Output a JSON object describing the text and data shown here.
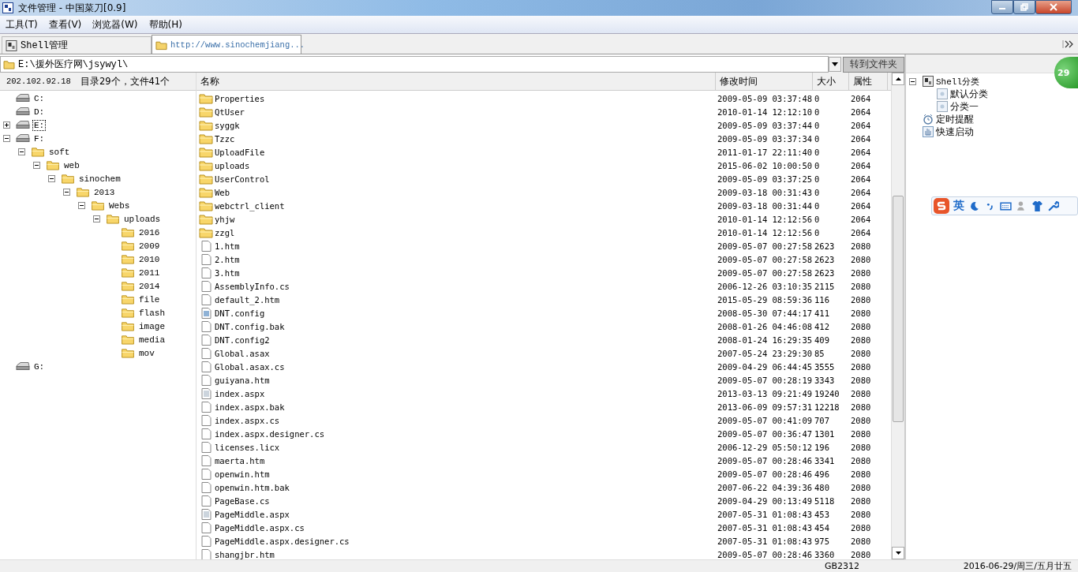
{
  "window": {
    "title": "文件管理 - 中国菜刀[0.9]"
  },
  "menu": [
    "工具(T)",
    "查看(V)",
    "浏览器(W)",
    "帮助(H)"
  ],
  "tabs": [
    {
      "label": "Shell管理",
      "kind": "shell",
      "selected": false
    },
    {
      "label": "http://www.sinochemjiang...",
      "kind": "folder",
      "selected": true
    }
  ],
  "path_bar": {
    "path": "E:\\援外医疗网\\jsywyl\\",
    "button": "转到文件夹"
  },
  "info": {
    "host": "202.102.92.18",
    "counts": "目录29个，文件41个"
  },
  "tree": [
    {
      "label": "C:",
      "kind": "drive",
      "selected": false
    },
    {
      "label": "D:",
      "kind": "drive",
      "selected": false
    },
    {
      "label": "E:",
      "kind": "drive",
      "selected": true,
      "expanded": false
    },
    {
      "label": "F:",
      "kind": "drive",
      "selected": false,
      "expanded": true,
      "children": [
        {
          "label": "soft",
          "kind": "folder",
          "selected": false,
          "expanded": true,
          "children": [
            {
              "label": "web",
              "kind": "folder",
              "selected": false,
              "expanded": true,
              "children": [
                {
                  "label": "sinochem",
                  "kind": "folder",
                  "selected": false,
                  "expanded": true,
                  "children": [
                    {
                      "label": "2013",
                      "kind": "folder",
                      "selected": false,
                      "expanded": true,
                      "children": [
                        {
                          "label": "Webs",
                          "kind": "folder",
                          "selected": false,
                          "expanded": true,
                          "children": [
                            {
                              "label": "uploads",
                              "kind": "folder",
                              "selected": false,
                              "expanded": true,
                              "children": [
                                {
                                  "label": "2016",
                                  "kind": "folder",
                                  "selected": false
                                },
                                {
                                  "label": "2009",
                                  "kind": "folder",
                                  "selected": false
                                },
                                {
                                  "label": "2010",
                                  "kind": "folder",
                                  "selected": false
                                },
                                {
                                  "label": "2011",
                                  "kind": "folder",
                                  "selected": false
                                },
                                {
                                  "label": "2014",
                                  "kind": "folder",
                                  "selected": false
                                },
                                {
                                  "label": "file",
                                  "kind": "folder",
                                  "selected": false
                                },
                                {
                                  "label": "flash",
                                  "kind": "folder",
                                  "selected": false
                                },
                                {
                                  "label": "image",
                                  "kind": "folder",
                                  "selected": false
                                },
                                {
                                  "label": "media",
                                  "kind": "folder",
                                  "selected": false
                                },
                                {
                                  "label": "mov",
                                  "kind": "folder",
                                  "selected": false
                                }
                              ]
                            }
                          ]
                        }
                      ]
                    }
                  ]
                }
              ]
            }
          ]
        }
      ]
    },
    {
      "label": "G:",
      "kind": "drive",
      "selected": false
    }
  ],
  "file_list": {
    "columns": [
      "名称",
      "修改时间",
      "大小",
      "属性"
    ],
    "rows": [
      {
        "name": "Properties",
        "kind": "folder",
        "modified": "2009-05-09 03:37:48",
        "size": "0",
        "attr": "2064"
      },
      {
        "name": "QtUser",
        "kind": "folder",
        "modified": "2010-01-14 12:12:10",
        "size": "0",
        "attr": "2064"
      },
      {
        "name": "syggk",
        "kind": "folder",
        "modified": "2009-05-09 03:37:44",
        "size": "0",
        "attr": "2064"
      },
      {
        "name": "Tzzc",
        "kind": "folder",
        "modified": "2009-05-09 03:37:34",
        "size": "0",
        "attr": "2064"
      },
      {
        "name": "UploadFile",
        "kind": "folder",
        "modified": "2011-01-17 22:11:40",
        "size": "0",
        "attr": "2064"
      },
      {
        "name": "uploads",
        "kind": "folder",
        "modified": "2015-06-02 10:00:50",
        "size": "0",
        "attr": "2064"
      },
      {
        "name": "UserControl",
        "kind": "folder",
        "modified": "2009-05-09 03:37:25",
        "size": "0",
        "attr": "2064"
      },
      {
        "name": "Web",
        "kind": "folder",
        "modified": "2009-03-18 00:31:43",
        "size": "0",
        "attr": "2064"
      },
      {
        "name": "webctrl_client",
        "kind": "folder",
        "modified": "2009-03-18 00:31:44",
        "size": "0",
        "attr": "2064"
      },
      {
        "name": "yhjw",
        "kind": "folder",
        "modified": "2010-01-14 12:12:56",
        "size": "0",
        "attr": "2064"
      },
      {
        "name": "zzgl",
        "kind": "folder",
        "modified": "2010-01-14 12:12:56",
        "size": "0",
        "attr": "2064"
      },
      {
        "name": "1.htm",
        "kind": "file",
        "modified": "2009-05-07 00:27:58",
        "size": "2623",
        "attr": "2080"
      },
      {
        "name": "2.htm",
        "kind": "file",
        "modified": "2009-05-07 00:27:58",
        "size": "2623",
        "attr": "2080"
      },
      {
        "name": "3.htm",
        "kind": "file",
        "modified": "2009-05-07 00:27:58",
        "size": "2623",
        "attr": "2080"
      },
      {
        "name": "AssemblyInfo.cs",
        "kind": "file",
        "modified": "2006-12-26 03:10:35",
        "size": "2115",
        "attr": "2080"
      },
      {
        "name": "default_2.htm",
        "kind": "file",
        "modified": "2015-05-29 08:59:36",
        "size": "116",
        "attr": "2080"
      },
      {
        "name": "DNT.config",
        "kind": "config",
        "modified": "2008-05-30 07:44:17",
        "size": "411",
        "attr": "2080"
      },
      {
        "name": "DNT.config.bak",
        "kind": "file",
        "modified": "2008-01-26 04:46:08",
        "size": "412",
        "attr": "2080"
      },
      {
        "name": "DNT.config2",
        "kind": "file",
        "modified": "2008-01-24 16:29:35",
        "size": "409",
        "attr": "2080"
      },
      {
        "name": "Global.asax",
        "kind": "file",
        "modified": "2007-05-24 23:29:30",
        "size": "85",
        "attr": "2080"
      },
      {
        "name": "Global.asax.cs",
        "kind": "file",
        "modified": "2009-04-29 06:44:45",
        "size": "3555",
        "attr": "2080"
      },
      {
        "name": "guiyana.htm",
        "kind": "file",
        "modified": "2009-05-07 00:28:19",
        "size": "3343",
        "attr": "2080"
      },
      {
        "name": "index.aspx",
        "kind": "text",
        "modified": "2013-03-13 09:21:49",
        "size": "19240",
        "attr": "2080"
      },
      {
        "name": "index.aspx.bak",
        "kind": "file",
        "modified": "2013-06-09 09:57:31",
        "size": "12218",
        "attr": "2080"
      },
      {
        "name": "index.aspx.cs",
        "kind": "file",
        "modified": "2009-05-07 00:41:09",
        "size": "707",
        "attr": "2080"
      },
      {
        "name": "index.aspx.designer.cs",
        "kind": "file",
        "modified": "2009-05-07 00:36:47",
        "size": "1301",
        "attr": "2080"
      },
      {
        "name": "licenses.licx",
        "kind": "file",
        "modified": "2006-12-29 05:50:12",
        "size": "196",
        "attr": "2080"
      },
      {
        "name": "maerta.htm",
        "kind": "file",
        "modified": "2009-05-07 00:28:46",
        "size": "3341",
        "attr": "2080"
      },
      {
        "name": "openwin.htm",
        "kind": "file",
        "modified": "2009-05-07 00:28:46",
        "size": "496",
        "attr": "2080"
      },
      {
        "name": "openwin.htm.bak",
        "kind": "file",
        "modified": "2007-06-22 04:39:36",
        "size": "480",
        "attr": "2080"
      },
      {
        "name": "PageBase.cs",
        "kind": "file",
        "modified": "2009-04-29 00:13:49",
        "size": "5118",
        "attr": "2080"
      },
      {
        "name": "PageMiddle.aspx",
        "kind": "text",
        "modified": "2007-05-31 01:08:43",
        "size": "453",
        "attr": "2080"
      },
      {
        "name": "PageMiddle.aspx.cs",
        "kind": "file",
        "modified": "2007-05-31 01:08:43",
        "size": "454",
        "attr": "2080"
      },
      {
        "name": "PageMiddle.aspx.designer.cs",
        "kind": "file",
        "modified": "2007-05-31 01:08:43",
        "size": "975",
        "attr": "2080"
      },
      {
        "name": "shangjbr.htm",
        "kind": "file",
        "modified": "2009-05-07 00:28:46",
        "size": "3360",
        "attr": "2080"
      }
    ]
  },
  "side_tree": [
    {
      "label": "Shell分类",
      "kind": "category",
      "expanded": true,
      "children": [
        {
          "label": "默认分类",
          "kind": "group"
        },
        {
          "label": "分类一",
          "kind": "group"
        }
      ]
    },
    {
      "label": "定时提醒",
      "kind": "alarm"
    },
    {
      "label": "快速启动",
      "kind": "launch"
    }
  ],
  "badge": "29",
  "ime_toolbar": {
    "mode": "英"
  },
  "status_bar": {
    "encoding": "GB2312",
    "datetime": "2016-06-29/周三/五月廿五"
  }
}
